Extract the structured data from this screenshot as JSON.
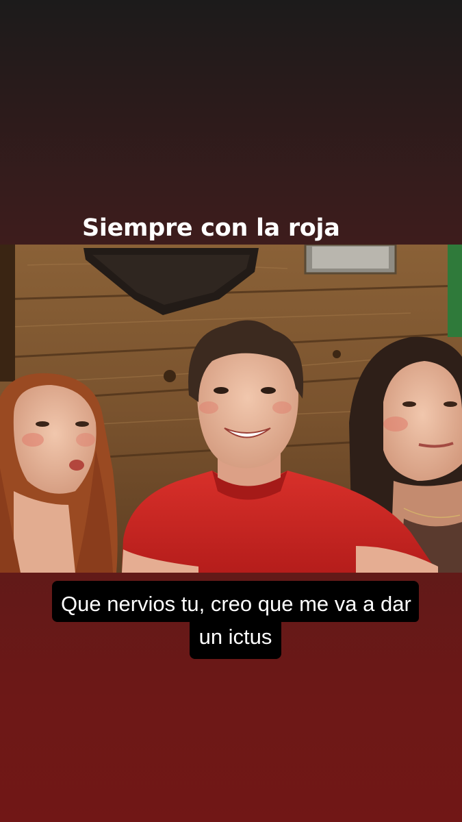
{
  "story": {
    "top_text": "Siempre con la roja",
    "bottom_text_line1": "Que nervios tu, creo que me va a dar",
    "bottom_text_line2": "un ictus"
  },
  "colors": {
    "background_top": "#1c1b1b",
    "background_bottom": "#711716",
    "caption_box": "#000000",
    "caption_text": "#ffffff",
    "shirt_red": "#c9221f",
    "wood": "#7a5430"
  }
}
